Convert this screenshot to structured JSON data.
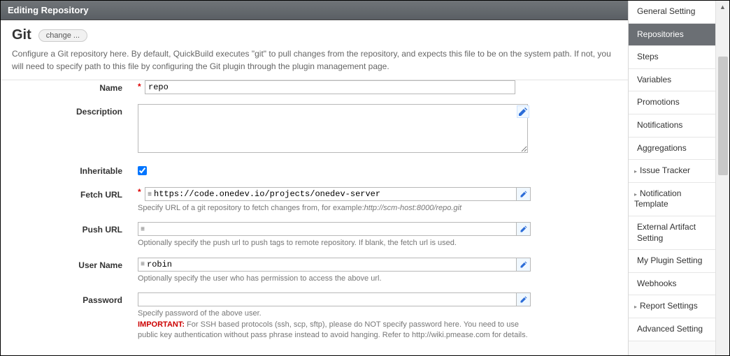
{
  "header": {
    "title": "Editing Repository"
  },
  "title": {
    "type": "Git",
    "change_label": "change ..."
  },
  "description": "Configure a Git repository here. By default, QuickBuild executes \"git\" to pull changes from the repository, and expects this file to be on the system path. If not, you will need to specify path to this file by configuring the Git plugin through the plugin management page.",
  "form": {
    "name": {
      "label": "Name",
      "value": "repo",
      "required": true
    },
    "desc": {
      "label": "Description",
      "value": ""
    },
    "inheritable": {
      "label": "Inheritable",
      "checked": true
    },
    "fetch_url": {
      "label": "Fetch URL",
      "value": "https://code.onedev.io/projects/onedev-server",
      "required": true,
      "help_prefix": "Specify URL of a git repository to fetch changes from, for example:",
      "help_example": "http://scm-host:8000/repo.git"
    },
    "push_url": {
      "label": "Push URL",
      "value": "",
      "help": "Optionally specify the push url to push tags to remote repository. If blank, the fetch url is used."
    },
    "user_name": {
      "label": "User Name",
      "value": "robin",
      "help": "Optionally specify the user who has permission to access the above url."
    },
    "password": {
      "label": "Password",
      "value": "",
      "help_line1": "Specify password of the above user.",
      "important_label": "IMPORTANT:",
      "help_line2": " For SSH based protocols (ssh, scp, sftp), please do NOT specify password here. You need to use public key authentication without pass phrase instead to avoid hanging. Refer to http://wiki.pmease.com for details."
    }
  },
  "sidebar": [
    {
      "id": "general",
      "label": "General Setting",
      "indent": false
    },
    {
      "id": "repositories",
      "label": "Repositories",
      "indent": false,
      "active": true
    },
    {
      "id": "steps",
      "label": "Steps",
      "indent": false
    },
    {
      "id": "variables",
      "label": "Variables",
      "indent": false
    },
    {
      "id": "promotions",
      "label": "Promotions",
      "indent": false
    },
    {
      "id": "notifications",
      "label": "Notifications",
      "indent": false
    },
    {
      "id": "aggregations",
      "label": "Aggregations",
      "indent": false
    },
    {
      "id": "issue-tracker",
      "label": "Issue Tracker",
      "indent": true
    },
    {
      "id": "notif-template",
      "label": "Notification Template",
      "indent": true
    },
    {
      "id": "ext-artifact",
      "label": "External Artifact Setting",
      "indent": false
    },
    {
      "id": "my-plugin",
      "label": "My Plugin Setting",
      "indent": false
    },
    {
      "id": "webhooks",
      "label": "Webhooks",
      "indent": false
    },
    {
      "id": "report-settings",
      "label": "Report Settings",
      "indent": true
    },
    {
      "id": "advanced",
      "label": "Advanced Setting",
      "indent": false
    }
  ]
}
